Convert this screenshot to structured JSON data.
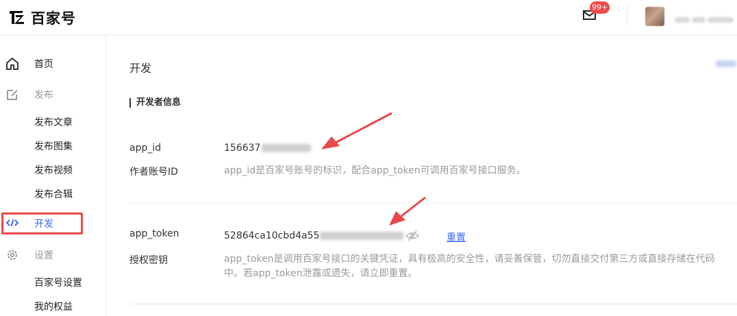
{
  "header": {
    "brand": "百家号",
    "badge": "99+",
    "username_masked": "████"
  },
  "sidebar": {
    "items": [
      {
        "label": "首页",
        "icon": "home-icon"
      },
      {
        "label": "发布",
        "icon": "edit-icon"
      },
      {
        "label": "发布文章"
      },
      {
        "label": "发布图集"
      },
      {
        "label": "发布视频"
      },
      {
        "label": "发布合辑"
      },
      {
        "label": "开发",
        "icon": "code-icon"
      },
      {
        "label": "设置",
        "icon": "gear-icon"
      },
      {
        "label": "百家号设置"
      },
      {
        "label": "我的权益"
      }
    ]
  },
  "main": {
    "title": "开发",
    "section_title": "开发者信息",
    "app_id": {
      "label": "app_id",
      "sublabel": "作者账号ID",
      "value_visible": "156637",
      "description": "app_id是百家号账号的标识，配合app_token可调用百家号接口服务。"
    },
    "app_token": {
      "label": "app_token",
      "sublabel": "授权密钥",
      "value_visible": "52864ca10cbd4a55",
      "reset_label": "重置",
      "description": "app_token是调用百家号接口的关键凭证，具有极高的安全性，请妥善保管，切勿直接交付第三方或直接存储在代码中。若app_token泄露或遗失，请立即重置。"
    }
  },
  "colors": {
    "accent": "#3d6bf5",
    "highlight": "#e8484b",
    "badge": "#f0484b",
    "muted_text": "#9a9a9a"
  }
}
